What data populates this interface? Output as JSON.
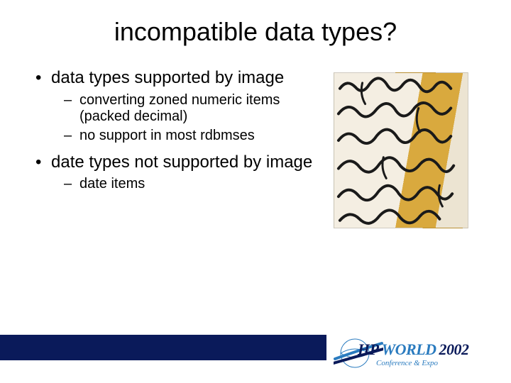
{
  "title": "incompatible data types?",
  "bullets": {
    "b1": "data types supported by image",
    "b1_1": "converting zoned numeric items (packed decimal)",
    "b1_2": "no support in most rdbmses",
    "b2": "date types not supported by image",
    "b2_1": "date items"
  },
  "logo": {
    "hp": "HP",
    "world": "WORLD",
    "year": "2002",
    "tagline": "Conference & Expo"
  }
}
